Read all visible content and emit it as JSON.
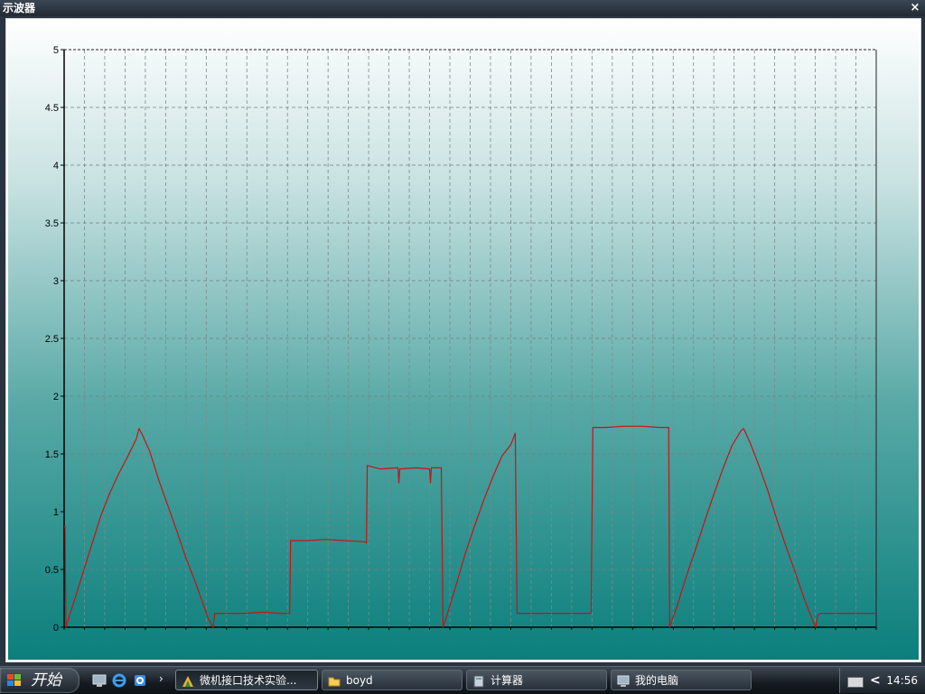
{
  "window": {
    "title": "示波器",
    "close_label": "×"
  },
  "chart_data": {
    "type": "line",
    "title": "",
    "xlabel": "",
    "ylabel": "",
    "ylim": [
      0,
      5
    ],
    "xlim": [
      0,
      900
    ],
    "grid": true,
    "y_ticks": [
      "0",
      "0.5",
      "1",
      "1.5",
      "2",
      "2.5",
      "3",
      "3.5",
      "4",
      "4.5",
      "5"
    ],
    "series": [
      {
        "color": "#cc1111",
        "points": [
          [
            0,
            0.87
          ],
          [
            1,
            0.87
          ],
          [
            2,
            0
          ],
          [
            5,
            0.08
          ],
          [
            10,
            0.2
          ],
          [
            20,
            0.45
          ],
          [
            30,
            0.7
          ],
          [
            40,
            0.95
          ],
          [
            50,
            1.15
          ],
          [
            60,
            1.32
          ],
          [
            70,
            1.47
          ],
          [
            80,
            1.63
          ],
          [
            83,
            1.72
          ],
          [
            87,
            1.66
          ],
          [
            95,
            1.52
          ],
          [
            105,
            1.27
          ],
          [
            115,
            1.05
          ],
          [
            125,
            0.83
          ],
          [
            135,
            0.6
          ],
          [
            145,
            0.4
          ],
          [
            155,
            0.18
          ],
          [
            160,
            0.07
          ],
          [
            165,
            0
          ],
          [
            167,
            0.12
          ],
          [
            180,
            0.12
          ],
          [
            200,
            0.12
          ],
          [
            220,
            0.13
          ],
          [
            240,
            0.12
          ],
          [
            250,
            0.12
          ],
          [
            251,
            0.75
          ],
          [
            270,
            0.75
          ],
          [
            290,
            0.76
          ],
          [
            310,
            0.75
          ],
          [
            333,
            0.74
          ],
          [
            335,
            0.73
          ],
          [
            336,
            1.4
          ],
          [
            350,
            1.37
          ],
          [
            370,
            1.38
          ],
          [
            371,
            1.25
          ],
          [
            372,
            1.37
          ],
          [
            390,
            1.38
          ],
          [
            405,
            1.37
          ],
          [
            406,
            1.25
          ],
          [
            407,
            1.38
          ],
          [
            418,
            1.38
          ],
          [
            420,
            0
          ],
          [
            425,
            0.12
          ],
          [
            435,
            0.38
          ],
          [
            445,
            0.65
          ],
          [
            455,
            0.88
          ],
          [
            465,
            1.1
          ],
          [
            475,
            1.3
          ],
          [
            485,
            1.48
          ],
          [
            495,
            1.58
          ],
          [
            500,
            1.68
          ],
          [
            502,
            0.12
          ],
          [
            520,
            0.12
          ],
          [
            540,
            0.12
          ],
          [
            560,
            0.12
          ],
          [
            584,
            0.12
          ],
          [
            586,
            1.73
          ],
          [
            600,
            1.73
          ],
          [
            620,
            1.74
          ],
          [
            640,
            1.74
          ],
          [
            660,
            1.73
          ],
          [
            670,
            1.73
          ],
          [
            671,
            0
          ],
          [
            680,
            0.2
          ],
          [
            690,
            0.45
          ],
          [
            700,
            0.68
          ],
          [
            710,
            0.92
          ],
          [
            720,
            1.15
          ],
          [
            730,
            1.37
          ],
          [
            740,
            1.57
          ],
          [
            750,
            1.7
          ],
          [
            753,
            1.72
          ],
          [
            760,
            1.6
          ],
          [
            770,
            1.4
          ],
          [
            780,
            1.18
          ],
          [
            790,
            0.93
          ],
          [
            800,
            0.7
          ],
          [
            810,
            0.48
          ],
          [
            820,
            0.25
          ],
          [
            830,
            0.05
          ],
          [
            833,
            0
          ],
          [
            835,
            0.1
          ],
          [
            838,
            0.12
          ],
          [
            860,
            0.12
          ],
          [
            880,
            0.12
          ],
          [
            900,
            0.12
          ]
        ]
      }
    ]
  },
  "taskbar": {
    "start_label": "开始",
    "tasks": [
      {
        "label": "微机接口技术实验...",
        "active": true
      },
      {
        "label": "boyd",
        "active": false
      },
      {
        "label": "计算器",
        "active": false
      },
      {
        "label": "我的电脑",
        "active": false
      }
    ],
    "clock": "14:56",
    "tray_arrow": "<",
    "quicklaunch_arrow": "›"
  }
}
